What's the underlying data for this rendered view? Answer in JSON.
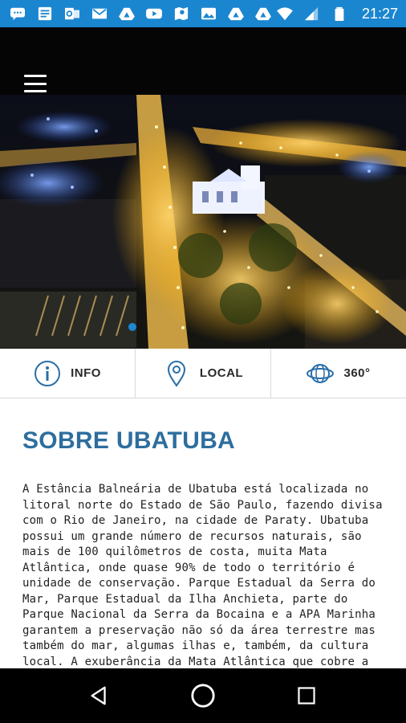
{
  "status_bar": {
    "time": "21:27",
    "icons": [
      "chat-icon",
      "document-icon",
      "outlook-icon",
      "gmail-icon",
      "drive-icon",
      "youtube-icon",
      "maps-icon",
      "image-icon",
      "drive-icon",
      "drive-icon",
      "wifi-icon",
      "signal-icon",
      "battery-icon"
    ],
    "background": "#1a86d0"
  },
  "hero": {
    "image_description_icon": "city-night-aerial-image",
    "active_page": 1
  },
  "tabs": [
    {
      "label": "INFO",
      "icon": "info-icon"
    },
    {
      "label": "LOCAL",
      "icon": "location-pin-icon"
    },
    {
      "label": "360°",
      "icon": "sphere-360-icon"
    }
  ],
  "content": {
    "title": "SOBRE UBATUBA",
    "body": "A Estância Balneária de Ubatuba está localizada no litoral norte do Estado de São Paulo, fazendo divisa com o Rio de Janeiro, na cidade de Paraty. Ubatuba possui um grande número de recursos naturais, são mais de 100 quilômetros de costa, muita Mata Atlântica, onde quase 90% de todo o território é unidade de conservação. Parque Estadual da Serra do Mar, Parque Estadual da Ilha Anchieta, parte do Parque Nacional da Serra da Bocaina e a APA Marinha garantem a preservação não só da área terrestre mas também do mar, algumas ilhas e, também, da cultura local. A exuberância da Mata Atlântica que cobre a",
    "title_color": "#2d6e9e"
  },
  "nav_bar": {
    "buttons": [
      "back-icon",
      "home-icon",
      "recents-icon"
    ]
  }
}
